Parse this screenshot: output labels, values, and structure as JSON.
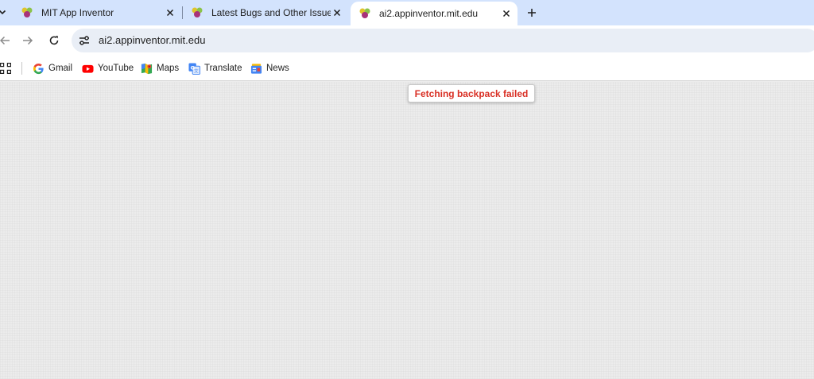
{
  "tabs": [
    {
      "title": "MIT App Inventor",
      "active": false
    },
    {
      "title": "Latest Bugs and Other Issues to",
      "active": false
    },
    {
      "title": "ai2.appinventor.mit.edu",
      "active": true
    }
  ],
  "toolbar": {
    "url": "ai2.appinventor.mit.edu",
    "icons": [
      "back-icon",
      "forward-icon",
      "reload-icon",
      "site-settings-icon"
    ]
  },
  "bookmarks": [
    {
      "label": "Gmail",
      "icon": "google-icon"
    },
    {
      "label": "YouTube",
      "icon": "youtube-icon"
    },
    {
      "label": "Maps",
      "icon": "maps-icon"
    },
    {
      "label": "Translate",
      "icon": "translate-icon"
    },
    {
      "label": "News",
      "icon": "news-icon"
    }
  ],
  "notification": {
    "message": "Fetching backpack failed",
    "color": "#d93025"
  },
  "colors": {
    "tabstrip": "#d3e3fd",
    "omnibox": "#e9eef6",
    "page_background": "#ececec"
  }
}
